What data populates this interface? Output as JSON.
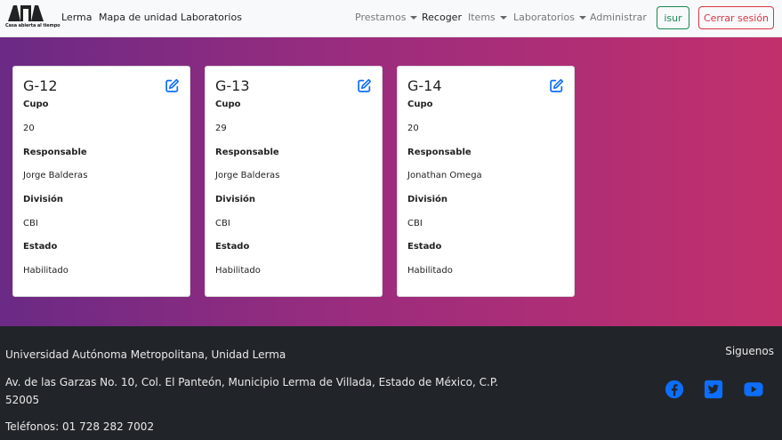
{
  "logo": {
    "caption": "Casa abierta al tiempo",
    "name": "UAM logo"
  },
  "nav": {
    "left": [
      "Lerma",
      "Mapa de unidad",
      "Laboratorios"
    ],
    "prestamos": "Prestamos",
    "recoger": "Recoger",
    "items": "Items",
    "laboratorios": "Laboratorios",
    "administrar": "Administrar",
    "user_button": "isur",
    "logout_button": "Cerrar sesión"
  },
  "labels": {
    "cupo": "Cupo",
    "responsable": "Responsable",
    "division": "División",
    "estado": "Estado"
  },
  "cards": [
    {
      "name": "G-12",
      "cupo": "20",
      "responsable": "Jorge Balderas",
      "division": "CBI",
      "estado": "Habilitado"
    },
    {
      "name": "G-13",
      "cupo": "29",
      "responsable": "Jorge Balderas",
      "division": "CBI",
      "estado": "Habilitado"
    },
    {
      "name": "G-14",
      "cupo": "20",
      "responsable": "Jonathan Omega",
      "division": "CBI",
      "estado": "Habilitado"
    }
  ],
  "footer": {
    "university": "Universidad Autónoma Metropolitana, Unidad Lerma",
    "address": "Av. de las Garzas No. 10, Col. El Panteón, Municipio Lerma de Villada, Estado de México, C.P. 52005",
    "phone": "Teléfonos: 01 728 282 7002",
    "follow": "Siguenos",
    "social_icons": [
      "facebook-icon",
      "twitter-icon",
      "youtube-icon"
    ]
  },
  "colors": {
    "accent": "#0d6efd",
    "success": "#198754",
    "danger": "#dc3545",
    "footer_bg": "#212529",
    "gradient_start": "#6a2a85",
    "gradient_end": "#c2306c"
  }
}
